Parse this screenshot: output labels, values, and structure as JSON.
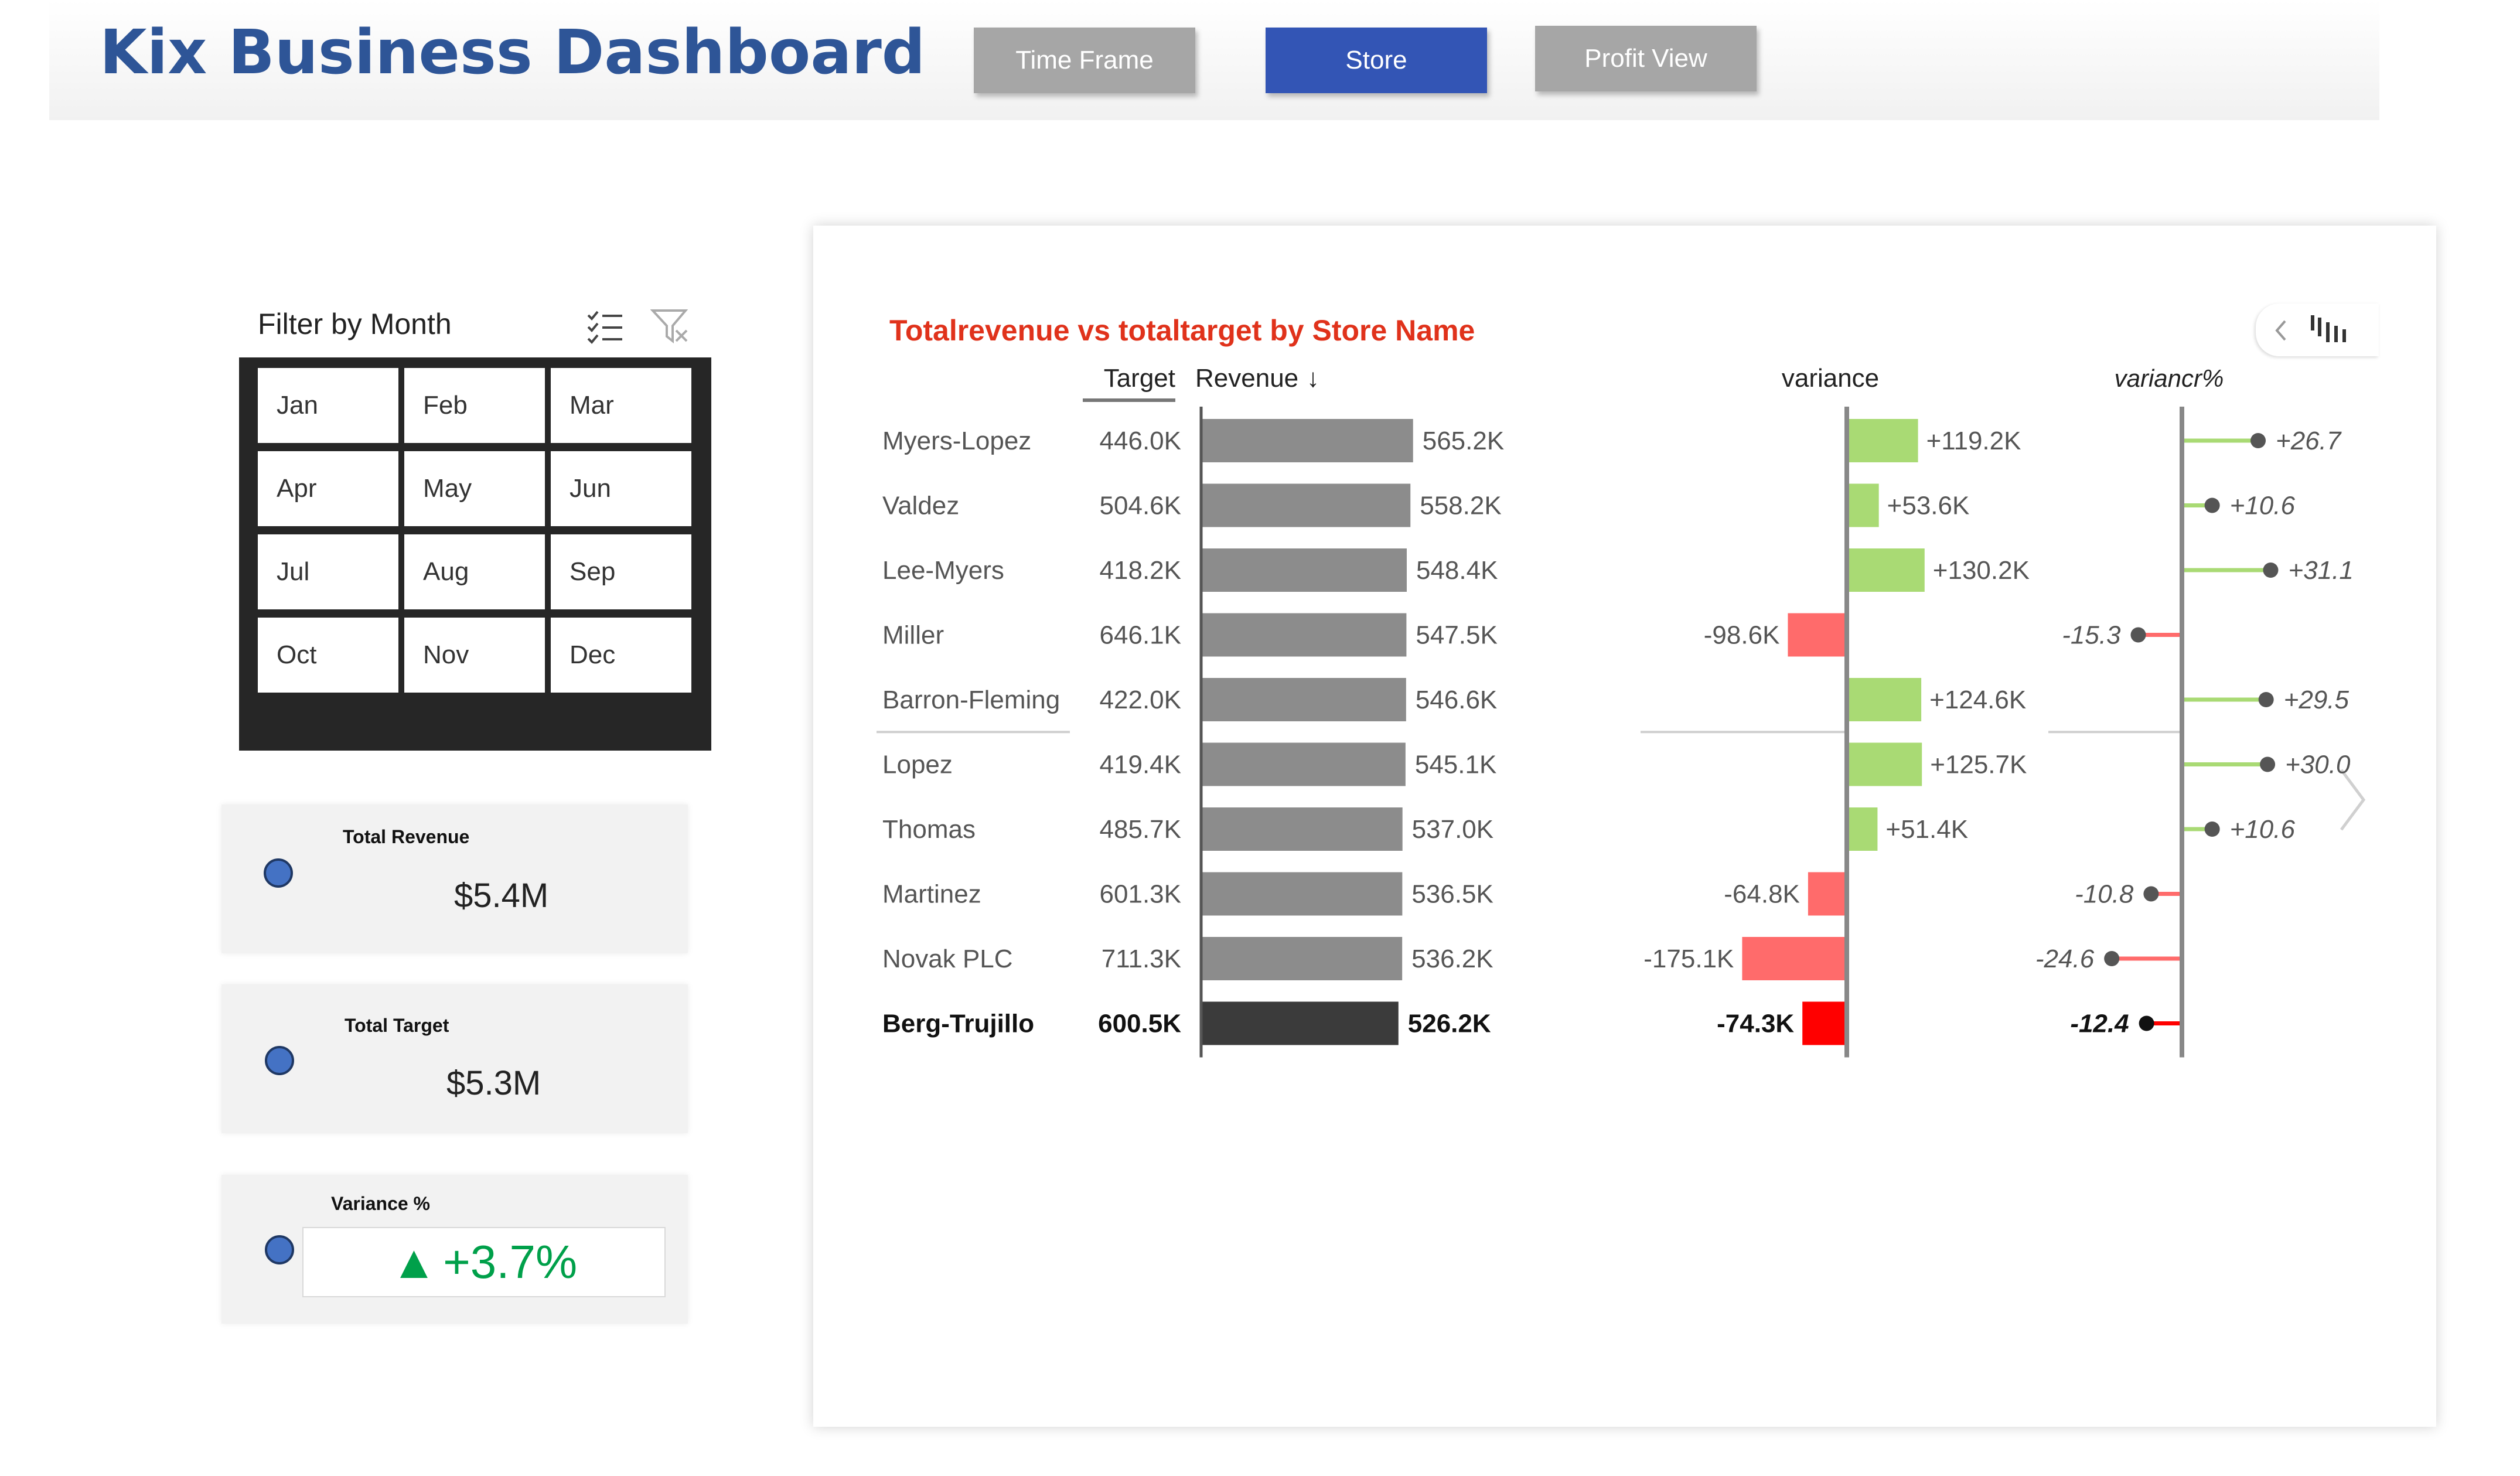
{
  "header": {
    "title": "Kix Business Dashboard",
    "nav": {
      "time_frame": "Time Frame",
      "store": "Store",
      "profit_view": "Profit View",
      "active": "Store"
    }
  },
  "slicer": {
    "title": "Filter by Month",
    "months": [
      "Jan",
      "Feb",
      "Mar",
      "Apr",
      "May",
      "Jun",
      "Jul",
      "Aug",
      "Sep",
      "Oct",
      "Nov",
      "Dec"
    ]
  },
  "kpis": {
    "revenue": {
      "label": "Total Revenue",
      "value": "$5.4M"
    },
    "target": {
      "label": "Total Target",
      "value": "$5.3M"
    },
    "variance": {
      "label": "Variance %",
      "value": "+3.7%",
      "arrow": "▲"
    }
  },
  "colors": {
    "accent": "#3355b5",
    "title_blue": "#2e5597",
    "chart_title": "#e0321b",
    "bar": "#8c8c8c",
    "bar_total": "#3b3b3b",
    "positive": "#a9da74",
    "negative": "#ff6b6b",
    "negative_total": "#ff0000",
    "kpi_up": "#00a04a"
  },
  "chart_data": {
    "type": "bar",
    "title": "Totalrevenue vs totaltarget by Store Name",
    "headers": {
      "target": "Target",
      "revenue": "Revenue",
      "sort_icon": "arrow-down-icon",
      "variance": "variance",
      "variance_pct": "variancr%"
    },
    "categories": [
      "Myers-Lopez",
      "Valdez",
      "Lee-Myers",
      "Miller",
      "Barron-Fleming",
      "Lopez",
      "Thomas",
      "Martinez",
      "Novak PLC",
      "Berg-Trujillo"
    ],
    "total_row": "Berg-Trujillo",
    "series": [
      {
        "name": "Target",
        "values": [
          446.0,
          504.6,
          418.2,
          646.1,
          422.0,
          419.4,
          485.7,
          601.3,
          711.3,
          600.5
        ],
        "labels": [
          "446.0K",
          "504.6K",
          "418.2K",
          "646.1K",
          "422.0K",
          "419.4K",
          "485.7K",
          "601.3K",
          "711.3K",
          "600.5K"
        ]
      },
      {
        "name": "Revenue",
        "values": [
          565.2,
          558.2,
          548.4,
          547.5,
          546.6,
          545.1,
          537.0,
          536.5,
          536.2,
          526.2
        ],
        "labels": [
          "565.2K",
          "558.2K",
          "548.4K",
          "547.5K",
          "546.6K",
          "545.1K",
          "537.0K",
          "536.5K",
          "536.2K",
          "526.2K"
        ]
      },
      {
        "name": "variance",
        "values": [
          119.2,
          53.6,
          130.2,
          -98.6,
          124.6,
          125.7,
          51.4,
          -64.8,
          -175.1,
          -74.3
        ],
        "labels": [
          "+119.2K",
          "+53.6K",
          "+130.2K",
          "-98.6K",
          "+124.6K",
          "+125.7K",
          "+51.4K",
          "-64.8K",
          "-175.1K",
          "-74.3K"
        ]
      },
      {
        "name": "variancr%",
        "values": [
          26.7,
          10.6,
          31.1,
          -15.3,
          29.5,
          30.0,
          10.6,
          -10.8,
          -24.6,
          -12.4
        ],
        "labels": [
          "+26.7",
          "+10.6",
          "+31.1",
          "-15.3",
          "+29.5",
          "+30.0",
          "+10.6",
          "-10.8",
          "-24.6",
          "-12.4"
        ]
      }
    ]
  }
}
